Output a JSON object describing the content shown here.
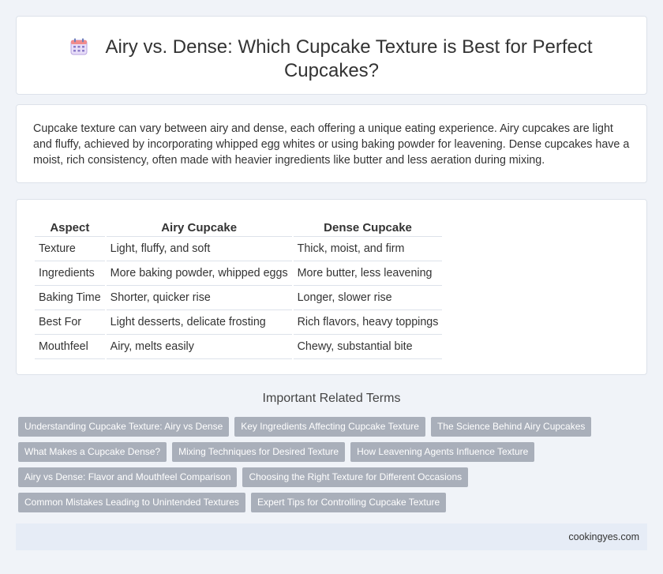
{
  "header": {
    "icon": "calendar-icon",
    "title": "Airy vs. Dense: Which Cupcake Texture is Best for Perfect Cupcakes?"
  },
  "intro": {
    "text": "Cupcake texture can vary between airy and dense, each offering a unique eating experience. Airy cupcakes are light and fluffy, achieved by incorporating whipped egg whites or using baking powder for leavening. Dense cupcakes have a moist, rich consistency, often made with heavier ingredients like butter and less aeration during mixing."
  },
  "table": {
    "headers": [
      "Aspect",
      "Airy Cupcake",
      "Dense Cupcake"
    ],
    "rows": [
      [
        "Texture",
        "Light, fluffy, and soft",
        "Thick, moist, and firm"
      ],
      [
        "Ingredients",
        "More baking powder, whipped eggs",
        "More butter, less leavening"
      ],
      [
        "Baking Time",
        "Shorter, quicker rise",
        "Longer, slower rise"
      ],
      [
        "Best For",
        "Light desserts, delicate frosting",
        "Rich flavors, heavy toppings"
      ],
      [
        "Mouthfeel",
        "Airy, melts easily",
        "Chewy, substantial bite"
      ]
    ]
  },
  "related": {
    "title": "Important Related Terms",
    "rows": [
      [
        "Understanding Cupcake Texture: Airy vs Dense",
        "Key Ingredients Affecting Cupcake Texture",
        "The Science Behind Airy Cupcakes"
      ],
      [
        "What Makes a Cupcake Dense?",
        "Mixing Techniques for Desired Texture",
        "How Leavening Agents Influence Texture"
      ],
      [
        "Airy vs Dense: Flavor and Mouthfeel Comparison",
        "Choosing the Right Texture for Different Occasions"
      ],
      [
        "Common Mistakes Leading to Unintended Textures",
        "Expert Tips for Controlling Cupcake Texture"
      ]
    ]
  },
  "footer": {
    "site": "cookingyes.com"
  }
}
